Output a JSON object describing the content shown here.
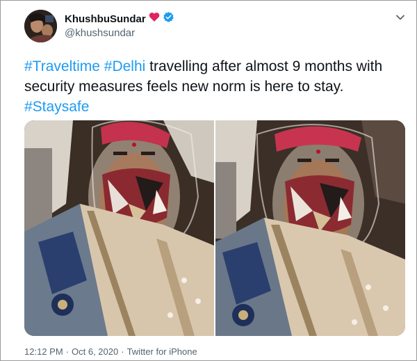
{
  "tweet": {
    "author": {
      "display_name": "KhushbuSundar",
      "handle": "@khushsundar",
      "heart_icon": "red-heart-icon",
      "verified_icon": "verified-badge-icon",
      "avatar_icon": "profile-avatar"
    },
    "menu_icon": "chevron-down-icon",
    "text": {
      "hashtag1": "#Traveltime",
      "hashtag2": "#Delhi",
      "body": " travelling after almost 9 months with security measures feels new norm is here to stay.",
      "hashtag3": "#Staysafe"
    },
    "media": [
      {
        "label": "photo-1"
      },
      {
        "label": "photo-2"
      }
    ],
    "meta": {
      "time": "12:12 PM",
      "separator": "·",
      "date": "Oct 6, 2020",
      "separator2": "·",
      "client": "Twitter for iPhone"
    },
    "colors": {
      "link": "#1d9bf0",
      "heart": "#e0245e",
      "verified": "#1d9bf0",
      "muted": "#536471"
    }
  }
}
